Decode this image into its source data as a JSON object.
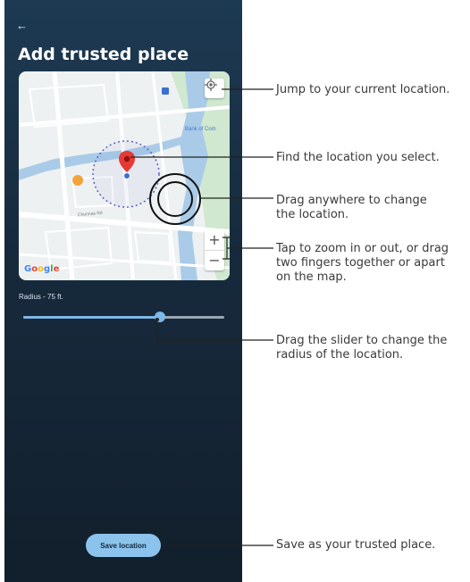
{
  "screen": {
    "back_icon": "arrow-left-icon",
    "title": "Add trusted place"
  },
  "map": {
    "poi_label": "Bank of Com",
    "road_label": "Chunnas Rd",
    "google_logo": [
      "G",
      "o",
      "o",
      "g",
      "l",
      "e"
    ],
    "google_colors": [
      "#4285F4",
      "#EA4335",
      "#FBBC05",
      "#4285F4",
      "#34A853",
      "#EA4335"
    ],
    "zoom_in": "+",
    "zoom_out": "−",
    "pin_color": "#e53935",
    "water_color": "#a9cbe8",
    "park_color": "#cfe8cf"
  },
  "radius": {
    "label": "Radius - 75 ft.",
    "slider_fraction": 0.68
  },
  "save_button": "Save location",
  "callouts": {
    "current_location": "Jump to your current location.",
    "find_location": "Find the location you select.",
    "drag_anywhere": [
      "Drag anywhere to change",
      "the location."
    ],
    "zoom": [
      "Tap to zoom in or out, or drag",
      "two fingers together or apart",
      "on the map."
    ],
    "slider": [
      "Drag the slider to change the",
      "radius of the location."
    ],
    "save": "Save as your trusted place."
  },
  "colors": {
    "panel": "#172b3e",
    "accent": "#8cc3ec"
  }
}
